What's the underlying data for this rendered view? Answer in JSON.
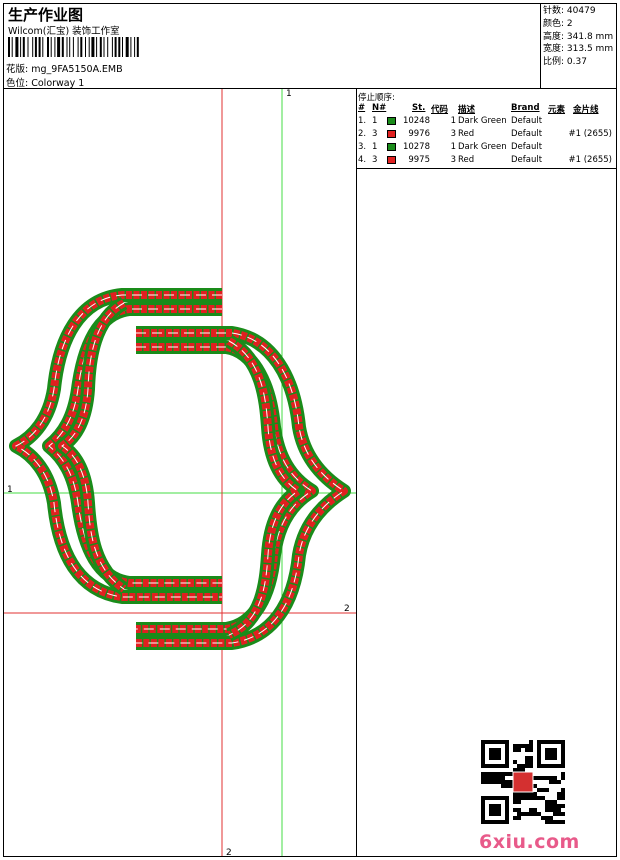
{
  "header": {
    "title": "生产作业图",
    "subtitle": "Wilcom(汇宝) 装饰工作室",
    "design_label": "花版: ",
    "design_value": "mg_9FA5150A.EMB",
    "colorway_label": "色位: ",
    "colorway_value": "Colorway 1"
  },
  "stats": [
    {
      "label": "针数:",
      "value": "40479"
    },
    {
      "label": "颜色:",
      "value": "2"
    },
    {
      "label": "高度:",
      "value": "341.8 mm"
    },
    {
      "label": "宽度:",
      "value": "313.5 mm"
    },
    {
      "label": "比例:",
      "value": "0.37"
    }
  ],
  "stop_sequence": {
    "title": "停止顺序:",
    "headers": [
      "#",
      "N#",
      "St.",
      "代码",
      "描述",
      "Brand",
      "元素",
      "金片线"
    ],
    "rows": [
      {
        "num": "1.",
        "n": "1",
        "color": "#1a8c1a",
        "st": "10248",
        "code": "1",
        "desc": "Dark Green",
        "brand": "Default",
        "elem": "",
        "seq": ""
      },
      {
        "num": "2.",
        "n": "3",
        "color": "#e02020",
        "st": "9976",
        "code": "3",
        "desc": "Red",
        "brand": "Default",
        "elem": "",
        "seq": "#1 (2655)"
      },
      {
        "num": "3.",
        "n": "1",
        "color": "#1a8c1a",
        "st": "10278",
        "code": "1",
        "desc": "Dark Green",
        "brand": "Default",
        "elem": "",
        "seq": ""
      },
      {
        "num": "4.",
        "n": "3",
        "color": "#e02020",
        "st": "9975",
        "code": "3",
        "desc": "Red",
        "brand": "Default",
        "elem": "",
        "seq": "#1 (2655)"
      }
    ]
  },
  "guides": {
    "green_v_label": "1",
    "green_h_label": "1",
    "red_h_label": "2",
    "red_v_label": "2"
  },
  "colors": {
    "dark_green": "#1a8c1a",
    "red": "#e02020",
    "guide_green": "#44dd44",
    "guide_red": "#e03030"
  },
  "watermark": "6xiu.com"
}
